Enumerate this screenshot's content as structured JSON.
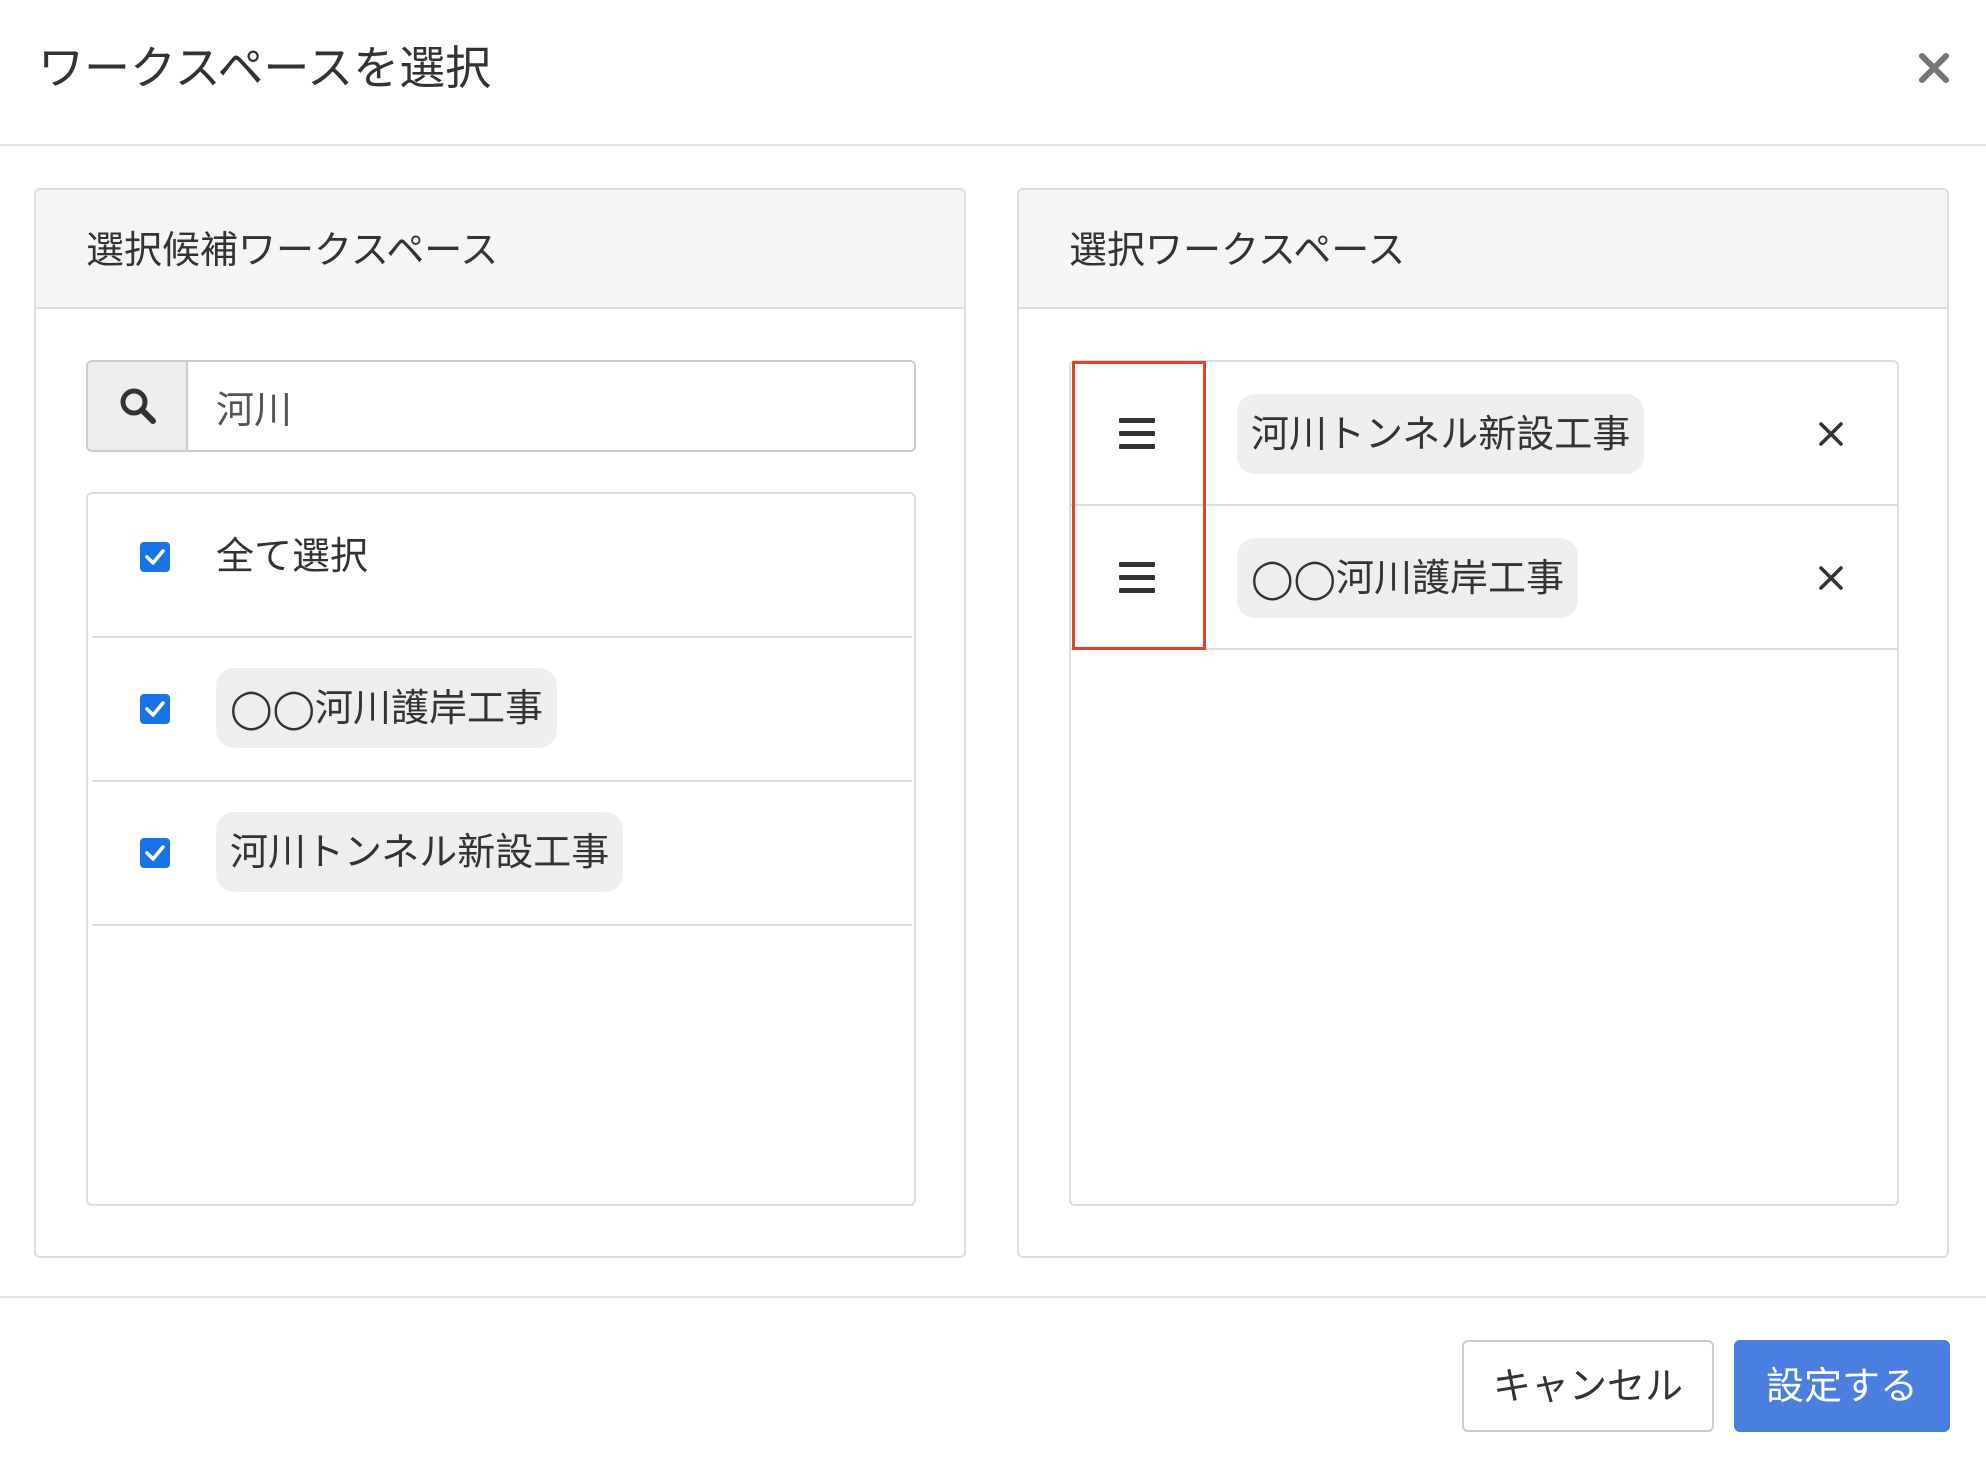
{
  "modal": {
    "title": "ワークスペースを選択"
  },
  "candidates_panel": {
    "title": "選択候補ワークスペース",
    "search": {
      "value": "河川",
      "placeholder": ""
    },
    "select_all": {
      "label": "全て選択",
      "checked": true
    },
    "items": [
      {
        "label": "◯◯河川護岸工事",
        "checked": true
      },
      {
        "label": "河川トンネル新設工事",
        "checked": true
      }
    ]
  },
  "selected_panel": {
    "title": "選択ワークスペース",
    "items": [
      {
        "label": "河川トンネル新設工事"
      },
      {
        "label": "◯◯河川護岸工事"
      }
    ]
  },
  "footer": {
    "cancel_label": "キャンセル",
    "submit_label": "設定する"
  },
  "colors": {
    "accent": "#4a7fe0",
    "checkbox": "#1a73e8",
    "highlight": "#e0442c",
    "tag_bg": "#eeeeee"
  },
  "icons": {
    "close": "close-icon",
    "search": "search-icon",
    "checkbox": "checkmark-icon",
    "drag": "drag-handle-icon",
    "remove": "remove-icon"
  }
}
